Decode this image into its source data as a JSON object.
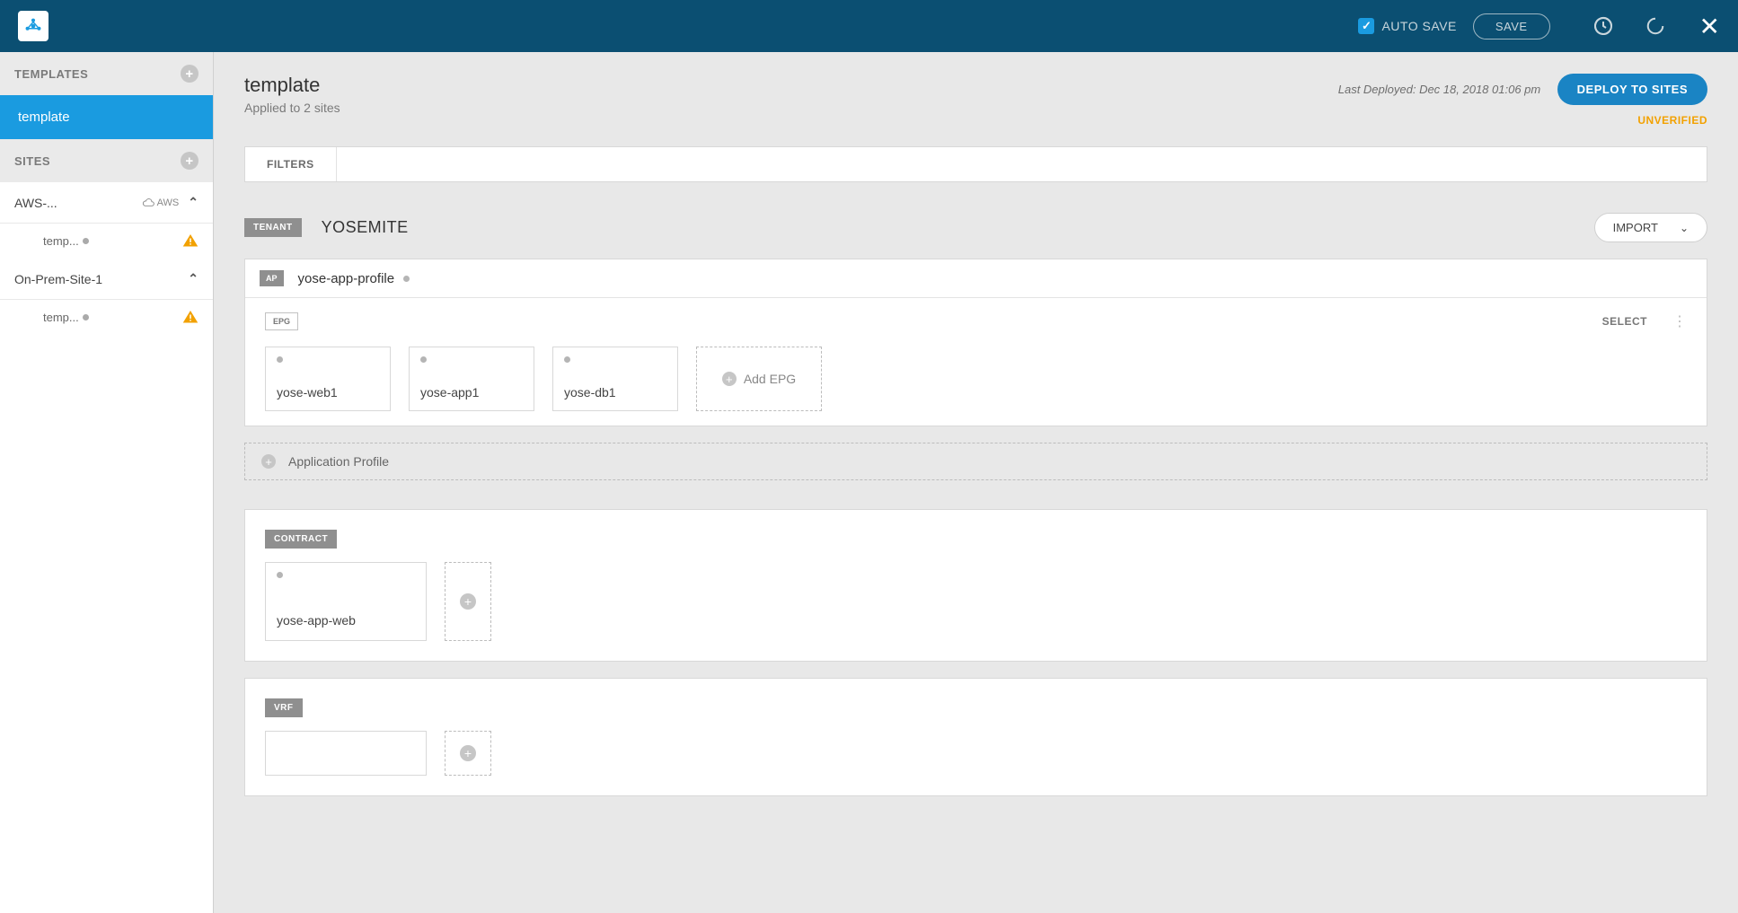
{
  "topbar": {
    "autosave_label": "AUTO SAVE",
    "save_label": "SAVE"
  },
  "sidebar": {
    "templates_header": "TEMPLATES",
    "template_item": "template",
    "sites_header": "SITES",
    "sites": [
      {
        "name": "AWS-...",
        "cloud_label": "AWS",
        "subtemplate": "temp..."
      },
      {
        "name": "On-Prem-Site-1",
        "subtemplate": "temp..."
      }
    ]
  },
  "main": {
    "title": "template",
    "applied": "Applied to 2 sites",
    "last_deployed": "Last Deployed: Dec 18, 2018 01:06 pm",
    "deploy_label": "DEPLOY TO SITES",
    "status": "UNVERIFIED",
    "filters_label": "FILTERS",
    "tenant_badge": "TENANT",
    "tenant_name": "YOSEMITE",
    "import_label": "IMPORT",
    "ap": {
      "badge": "AP",
      "name": "yose-app-profile",
      "epg_badge": "EPG",
      "select_label": "SELECT",
      "epgs": [
        "yose-web1",
        "yose-app1",
        "yose-db1"
      ],
      "add_epg_label": "Add EPG"
    },
    "add_app_profile_label": "Application Profile",
    "contract": {
      "badge": "CONTRACT",
      "items": [
        "yose-app-web"
      ]
    },
    "vrf_badge": "VRF"
  }
}
